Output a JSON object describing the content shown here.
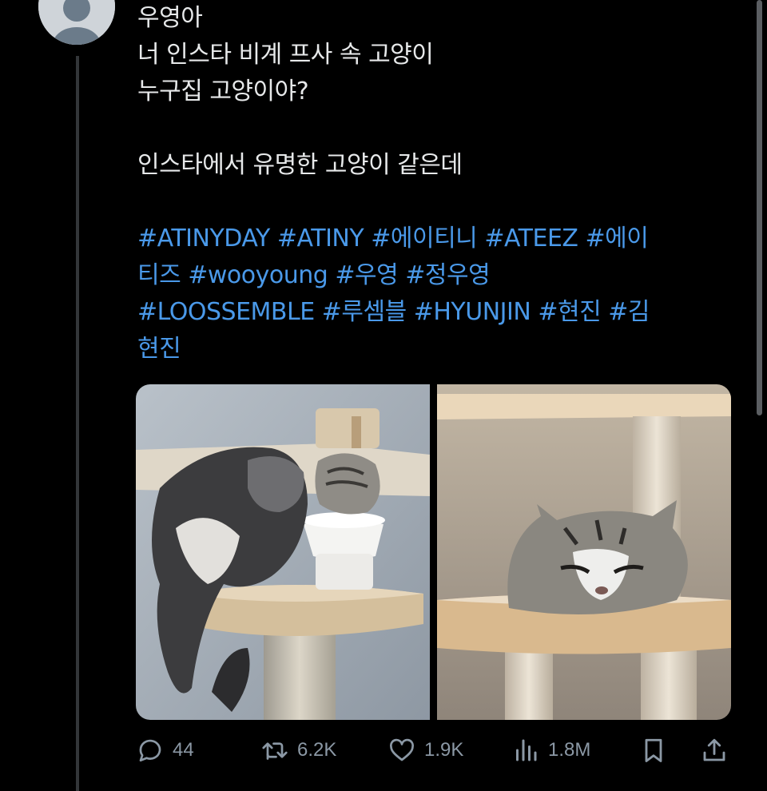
{
  "tweet": {
    "text_lines": [
      "우영아",
      "너 인스타 비계 프사 속 고양이",
      "누구집 고양이야?",
      "",
      "인스타에서 유명한 고양이 같은데"
    ],
    "hashtags": [
      "#ATINYDAY",
      "#ATINY",
      "#에이티니",
      "#ATEEZ",
      "#에이티즈",
      "#wooyoung",
      "#우영",
      "#정우영",
      "#LOOSSEMBLE",
      "#루셈블",
      "#HYUNJIN",
      "#현진",
      "#김현진"
    ],
    "hashtag_color": "#4a99e9",
    "text_color": "#e7e9ea",
    "background": "#000000"
  },
  "media": [
    {
      "icon": "cat-photo-two-cats-drinking-from-bowl"
    },
    {
      "icon": "cat-photo-tabby-cat-lying-on-shelf"
    }
  ],
  "actions": {
    "reply": {
      "icon": "reply-icon",
      "count": "44"
    },
    "retweet": {
      "icon": "retweet-icon",
      "count": "6.2K"
    },
    "like": {
      "icon": "heart-icon",
      "count": "1.9K"
    },
    "views": {
      "icon": "views-icon",
      "count": "1.8M"
    },
    "bookmark": {
      "icon": "bookmark-icon"
    },
    "share": {
      "icon": "share-icon"
    },
    "icon_color": "#8b98a5"
  }
}
